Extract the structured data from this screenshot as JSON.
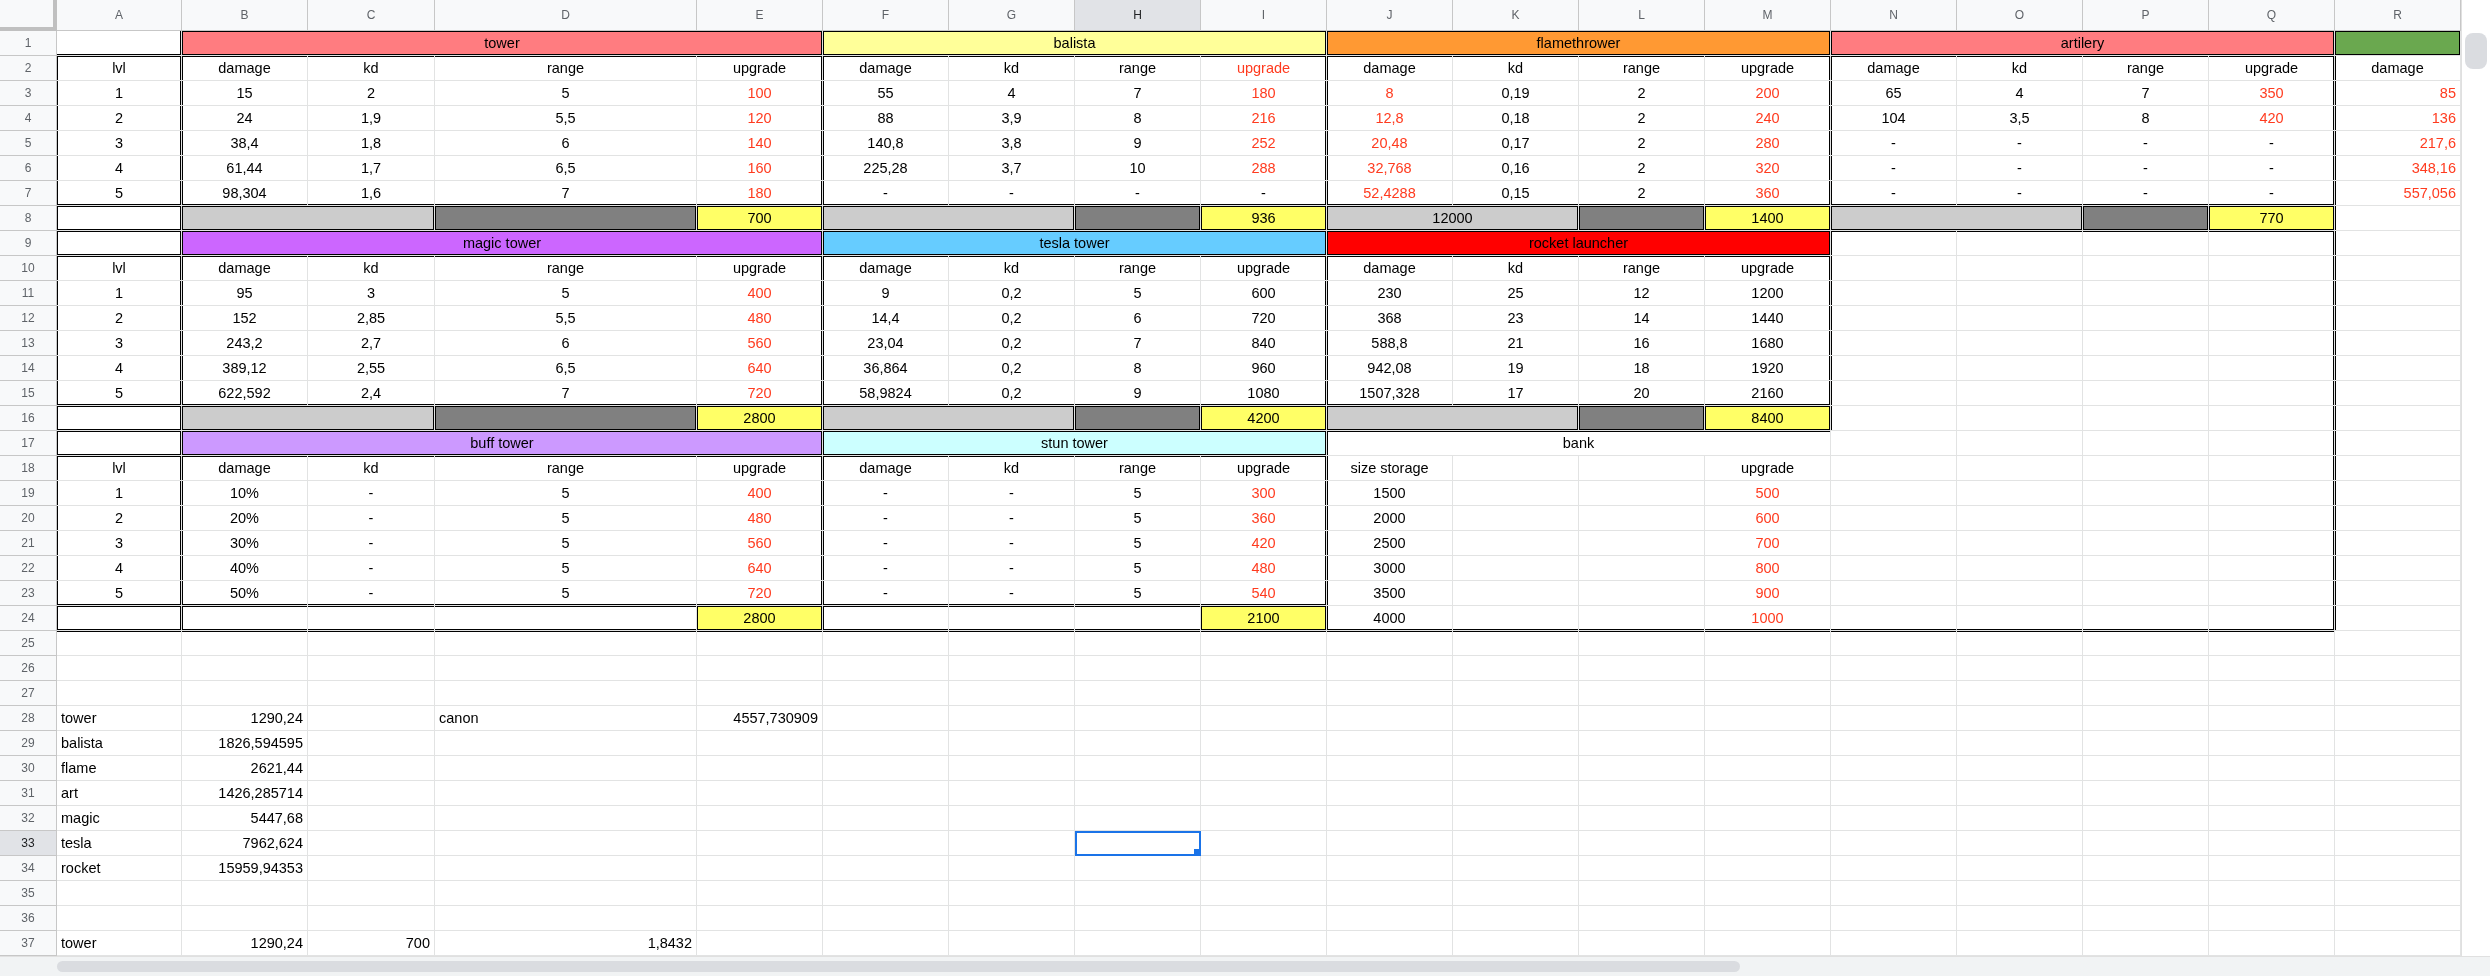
{
  "columns": [
    {
      "label": "A",
      "selected": false
    },
    {
      "label": "B",
      "selected": false
    },
    {
      "label": "C",
      "selected": false
    },
    {
      "label": "D",
      "selected": false
    },
    {
      "label": "E",
      "selected": false
    },
    {
      "label": "F",
      "selected": false
    },
    {
      "label": "G",
      "selected": false
    },
    {
      "label": "H",
      "selected": true
    },
    {
      "label": "I",
      "selected": false
    },
    {
      "label": "J",
      "selected": false
    },
    {
      "label": "K",
      "selected": false
    },
    {
      "label": "L",
      "selected": false
    },
    {
      "label": "M",
      "selected": false
    },
    {
      "label": "N",
      "selected": false
    },
    {
      "label": "O",
      "selected": false
    },
    {
      "label": "P",
      "selected": false
    },
    {
      "label": "Q",
      "selected": false
    },
    {
      "label": "R",
      "selected": false
    }
  ],
  "rows": [
    {
      "number": "1",
      "selected": false,
      "cells": [
        {
          "kind": "blank"
        },
        {
          "kind": "text",
          "text": "tower",
          "color": "#ff7c80"
        },
        {
          "kind": "merged"
        },
        {
          "kind": "merged"
        },
        {
          "kind": "merged"
        },
        {
          "kind": "text",
          "text": "balista",
          "color": "#ffff99"
        },
        {
          "kind": "merged"
        },
        {
          "kind": "merged"
        },
        {
          "kind": "merged"
        },
        {
          "kind": "text",
          "text": "flamethrower",
          "color": "#ff9933"
        },
        {
          "kind": "merged"
        },
        {
          "kind": "merged"
        },
        {
          "kind": "merged"
        },
        {
          "kind": "text",
          "text": "artilery",
          "color": "#ff7c80"
        },
        {
          "kind": "merged"
        },
        {
          "kind": "merged"
        },
        {
          "kind": "merged"
        },
        {
          "kind": "blank",
          "color": "#6aa84f"
        }
      ]
    },
    {
      "number": "2",
      "selected": false,
      "cells": [
        {
          "kind": "text",
          "text": "lvl"
        },
        {
          "kind": "text",
          "text": "damage"
        },
        {
          "kind": "text",
          "text": "kd"
        },
        {
          "kind": "text",
          "text": "range"
        },
        {
          "kind": "text",
          "text": "upgrade"
        },
        {
          "kind": "text",
          "text": "damage"
        },
        {
          "kind": "text",
          "text": "kd"
        },
        {
          "kind": "text",
          "text": "range"
        },
        {
          "kind": "flagged",
          "text": "upgrade"
        },
        {
          "kind": "text",
          "text": "damage"
        },
        {
          "kind": "text",
          "text": "kd"
        },
        {
          "kind": "text",
          "text": "range"
        },
        {
          "kind": "text",
          "text": "upgrade"
        },
        {
          "kind": "text",
          "text": "damage"
        },
        {
          "kind": "text",
          "text": "kd"
        },
        {
          "kind": "text",
          "text": "range"
        },
        {
          "kind": "text",
          "text": "upgrade"
        },
        {
          "kind": "text",
          "text": "damage"
        }
      ]
    },
    {
      "number": "3",
      "selected": false,
      "cells": [
        {
          "kind": "text",
          "text": "1"
        },
        {
          "kind": "text",
          "text": "15"
        },
        {
          "kind": "text",
          "text": "2"
        },
        {
          "kind": "text",
          "text": "5"
        },
        {
          "kind": "flagged",
          "text": "100"
        },
        {
          "kind": "text",
          "text": "55"
        },
        {
          "kind": "text",
          "text": "4"
        },
        {
          "kind": "text",
          "text": "7"
        },
        {
          "kind": "flagged",
          "text": "180"
        },
        {
          "kind": "flagged",
          "text": "8"
        },
        {
          "kind": "text",
          "text": "0,19"
        },
        {
          "kind": "text",
          "text": "2"
        },
        {
          "kind": "flagged",
          "text": "200"
        },
        {
          "kind": "text",
          "text": "65"
        },
        {
          "kind": "text",
          "text": "4"
        },
        {
          "kind": "text",
          "text": "7"
        },
        {
          "kind": "flagged",
          "text": "350"
        },
        {
          "kind": "alert",
          "text": "85"
        }
      ]
    },
    {
      "number": "4",
      "selected": false,
      "cells": [
        {
          "kind": "text",
          "text": "2"
        },
        {
          "kind": "text",
          "text": "24"
        },
        {
          "kind": "text",
          "text": "1,9"
        },
        {
          "kind": "text",
          "text": "5,5"
        },
        {
          "kind": "flagged",
          "text": "120"
        },
        {
          "kind": "text",
          "text": "88"
        },
        {
          "kind": "text",
          "text": "3,9"
        },
        {
          "kind": "text",
          "text": "8"
        },
        {
          "kind": "flagged",
          "text": "216"
        },
        {
          "kind": "flagged",
          "text": "12,8"
        },
        {
          "kind": "text",
          "text": "0,18"
        },
        {
          "kind": "text",
          "text": "2"
        },
        {
          "kind": "flagged",
          "text": "240"
        },
        {
          "kind": "text",
          "text": "104"
        },
        {
          "kind": "text",
          "text": "3,5"
        },
        {
          "kind": "text",
          "text": "8"
        },
        {
          "kind": "flagged",
          "text": "420"
        },
        {
          "kind": "alert",
          "text": "136"
        }
      ]
    },
    {
      "number": "5",
      "selected": false,
      "cells": [
        {
          "kind": "text",
          "text": "3"
        },
        {
          "kind": "text",
          "text": "38,4"
        },
        {
          "kind": "text",
          "text": "1,8"
        },
        {
          "kind": "text",
          "text": "6"
        },
        {
          "kind": "flagged",
          "text": "140"
        },
        {
          "kind": "text",
          "text": "140,8"
        },
        {
          "kind": "text",
          "text": "3,8"
        },
        {
          "kind": "text",
          "text": "9"
        },
        {
          "kind": "flagged",
          "text": "252"
        },
        {
          "kind": "flagged",
          "text": "20,48"
        },
        {
          "kind": "text",
          "text": "0,17"
        },
        {
          "kind": "text",
          "text": "2"
        },
        {
          "kind": "flagged",
          "text": "280"
        },
        {
          "kind": "text",
          "text": "-"
        },
        {
          "kind": "text",
          "text": "-"
        },
        {
          "kind": "text",
          "text": "-"
        },
        {
          "kind": "text",
          "text": "-"
        },
        {
          "kind": "alert",
          "text": "217,6"
        }
      ]
    },
    {
      "number": "6",
      "selected": false,
      "cells": [
        {
          "kind": "text",
          "text": "4"
        },
        {
          "kind": "text",
          "text": "61,44"
        },
        {
          "kind": "text",
          "text": "1,7"
        },
        {
          "kind": "text",
          "text": "6,5"
        },
        {
          "kind": "flagged",
          "text": "160"
        },
        {
          "kind": "text",
          "text": "225,28"
        },
        {
          "kind": "text",
          "text": "3,7"
        },
        {
          "kind": "text",
          "text": "10"
        },
        {
          "kind": "flagged",
          "text": "288"
        },
        {
          "kind": "flagged",
          "text": "32,768"
        },
        {
          "kind": "text",
          "text": "0,16"
        },
        {
          "kind": "text",
          "text": "2"
        },
        {
          "kind": "flagged",
          "text": "320"
        },
        {
          "kind": "text",
          "text": "-"
        },
        {
          "kind": "text",
          "text": "-"
        },
        {
          "kind": "text",
          "text": "-"
        },
        {
          "kind": "text",
          "text": "-"
        },
        {
          "kind": "alert",
          "text": "348,16"
        }
      ]
    },
    {
      "number": "7",
      "selected": false,
      "cells": [
        {
          "kind": "text",
          "text": "5"
        },
        {
          "kind": "text",
          "text": "98,304"
        },
        {
          "kind": "text",
          "text": "1,6"
        },
        {
          "kind": "text",
          "text": "7"
        },
        {
          "kind": "flagged",
          "text": "180"
        },
        {
          "kind": "text",
          "text": "-"
        },
        {
          "kind": "text",
          "text": "-"
        },
        {
          "kind": "text",
          "text": "-"
        },
        {
          "kind": "text",
          "text": "-"
        },
        {
          "kind": "flagged",
          "text": "52,4288"
        },
        {
          "kind": "text",
          "text": "0,15"
        },
        {
          "kind": "text",
          "text": "2"
        },
        {
          "kind": "flagged",
          "text": "360"
        },
        {
          "kind": "text",
          "text": "-"
        },
        {
          "kind": "text",
          "text": "-"
        },
        {
          "kind": "text",
          "text": "-"
        },
        {
          "kind": "text",
          "text": "-"
        },
        {
          "kind": "alert",
          "text": "557,056"
        }
      ]
    },
    {
      "number": "8",
      "selected": false,
      "cells": [
        {
          "kind": "blank"
        },
        {
          "kind": "blank",
          "color": "#cccccc"
        },
        {
          "kind": "merged"
        },
        {
          "kind": "blank",
          "color": "#808080"
        },
        {
          "kind": "text",
          "text": "700",
          "color": "#ffff66"
        },
        {
          "kind": "blank",
          "color": "#cccccc"
        },
        {
          "kind": "merged"
        },
        {
          "kind": "blank",
          "color": "#808080"
        },
        {
          "kind": "text",
          "text": "936",
          "color": "#ffff66"
        },
        {
          "kind": "text",
          "text": "12000",
          "color": "#cccccc"
        },
        {
          "kind": "merged"
        },
        {
          "kind": "blank",
          "color": "#808080"
        },
        {
          "kind": "text",
          "text": "1400",
          "color": "#ffff66"
        },
        {
          "kind": "blank",
          "color": "#cccccc"
        },
        {
          "kind": "merged"
        },
        {
          "kind": "blank",
          "color": "#808080"
        },
        {
          "kind": "text",
          "text": "770",
          "color": "#ffff66"
        }
      ]
    },
    {
      "number": "9",
      "selected": false,
      "cells": [
        {
          "kind": "blank"
        },
        {
          "kind": "text",
          "text": "magic tower",
          "color": "#cc66ff"
        },
        {
          "kind": "merged"
        },
        {
          "kind": "merged"
        },
        {
          "kind": "merged"
        },
        {
          "kind": "text",
          "text": "tesla tower",
          "color": "#66ccff"
        },
        {
          "kind": "merged"
        },
        {
          "kind": "merged"
        },
        {
          "kind": "merged"
        },
        {
          "kind": "text",
          "text": "rocket launcher",
          "color": "#ff0000"
        },
        {
          "kind": "merged"
        },
        {
          "kind": "merged"
        },
        {
          "kind": "merged"
        }
      ]
    },
    {
      "number": "10",
      "selected": false,
      "cells": [
        {
          "kind": "text",
          "text": "lvl"
        },
        {
          "kind": "text",
          "text": "damage"
        },
        {
          "kind": "text",
          "text": "kd"
        },
        {
          "kind": "text",
          "text": "range"
        },
        {
          "kind": "text",
          "text": "upgrade"
        },
        {
          "kind": "text",
          "text": "damage"
        },
        {
          "kind": "text",
          "text": "kd"
        },
        {
          "kind": "text",
          "text": "range"
        },
        {
          "kind": "text",
          "text": "upgrade"
        },
        {
          "kind": "text",
          "text": "damage"
        },
        {
          "kind": "text",
          "text": "kd"
        },
        {
          "kind": "text",
          "text": "range"
        },
        {
          "kind": "text",
          "text": "upgrade"
        }
      ]
    },
    {
      "number": "11",
      "selected": false,
      "cells": [
        {
          "kind": "text",
          "text": "1"
        },
        {
          "kind": "text",
          "text": "95"
        },
        {
          "kind": "text",
          "text": "3"
        },
        {
          "kind": "text",
          "text": "5"
        },
        {
          "kind": "flagged",
          "text": "400"
        },
        {
          "kind": "text",
          "text": "9"
        },
        {
          "kind": "text",
          "text": "0,2"
        },
        {
          "kind": "text",
          "text": "5"
        },
        {
          "kind": "text",
          "text": "600"
        },
        {
          "kind": "text",
          "text": "230"
        },
        {
          "kind": "text",
          "text": "25"
        },
        {
          "kind": "text",
          "text": "12"
        },
        {
          "kind": "text",
          "text": "1200"
        }
      ]
    },
    {
      "number": "12",
      "selected": false,
      "cells": [
        {
          "kind": "text",
          "text": "2"
        },
        {
          "kind": "text",
          "text": "152"
        },
        {
          "kind": "text",
          "text": "2,85"
        },
        {
          "kind": "text",
          "text": "5,5"
        },
        {
          "kind": "flagged",
          "text": "480"
        },
        {
          "kind": "text",
          "text": "14,4"
        },
        {
          "kind": "text",
          "text": "0,2"
        },
        {
          "kind": "text",
          "text": "6"
        },
        {
          "kind": "text",
          "text": "720"
        },
        {
          "kind": "text",
          "text": "368"
        },
        {
          "kind": "text",
          "text": "23"
        },
        {
          "kind": "text",
          "text": "14"
        },
        {
          "kind": "text",
          "text": "1440"
        }
      ]
    },
    {
      "number": "13",
      "selected": false,
      "cells": [
        {
          "kind": "text",
          "text": "3"
        },
        {
          "kind": "text",
          "text": "243,2"
        },
        {
          "kind": "text",
          "text": "2,7"
        },
        {
          "kind": "text",
          "text": "6"
        },
        {
          "kind": "flagged",
          "text": "560"
        },
        {
          "kind": "text",
          "text": "23,04"
        },
        {
          "kind": "text",
          "text": "0,2"
        },
        {
          "kind": "text",
          "text": "7"
        },
        {
          "kind": "text",
          "text": "840"
        },
        {
          "kind": "text",
          "text": "588,8"
        },
        {
          "kind": "text",
          "text": "21"
        },
        {
          "kind": "text",
          "text": "16"
        },
        {
          "kind": "text",
          "text": "1680"
        }
      ]
    },
    {
      "number": "14",
      "selected": false,
      "cells": [
        {
          "kind": "text",
          "text": "4"
        },
        {
          "kind": "text",
          "text": "389,12"
        },
        {
          "kind": "text",
          "text": "2,55"
        },
        {
          "kind": "text",
          "text": "6,5"
        },
        {
          "kind": "flagged",
          "text": "640"
        },
        {
          "kind": "text",
          "text": "36,864"
        },
        {
          "kind": "text",
          "text": "0,2"
        },
        {
          "kind": "text",
          "text": "8"
        },
        {
          "kind": "text",
          "text": "960"
        },
        {
          "kind": "text",
          "text": "942,08"
        },
        {
          "kind": "text",
          "text": "19"
        },
        {
          "kind": "text",
          "text": "18"
        },
        {
          "kind": "text",
          "text": "1920"
        }
      ]
    },
    {
      "number": "15",
      "selected": false,
      "cells": [
        {
          "kind": "text",
          "text": "5"
        },
        {
          "kind": "text",
          "text": "622,592"
        },
        {
          "kind": "text",
          "text": "2,4"
        },
        {
          "kind": "text",
          "text": "7"
        },
        {
          "kind": "flagged",
          "text": "720"
        },
        {
          "kind": "text",
          "text": "58,9824"
        },
        {
          "kind": "text",
          "text": "0,2"
        },
        {
          "kind": "text",
          "text": "9"
        },
        {
          "kind": "text",
          "text": "1080"
        },
        {
          "kind": "text",
          "text": "1507,328"
        },
        {
          "kind": "text",
          "text": "17"
        },
        {
          "kind": "text",
          "text": "20"
        },
        {
          "kind": "text",
          "text": "2160"
        }
      ]
    },
    {
      "number": "16",
      "selected": false,
      "cells": [
        {
          "kind": "blank"
        },
        {
          "kind": "blank",
          "color": "#cccccc"
        },
        {
          "kind": "merged"
        },
        {
          "kind": "blank",
          "color": "#808080"
        },
        {
          "kind": "text",
          "text": "2800",
          "color": "#ffff66"
        },
        {
          "kind": "blank",
          "color": "#cccccc"
        },
        {
          "kind": "merged"
        },
        {
          "kind": "blank",
          "color": "#808080"
        },
        {
          "kind": "text",
          "text": "4200",
          "color": "#ffff66"
        },
        {
          "kind": "blank",
          "color": "#cccccc"
        },
        {
          "kind": "merged"
        },
        {
          "kind": "blank",
          "color": "#808080"
        },
        {
          "kind": "text",
          "text": "8400",
          "color": "#ffff66"
        }
      ]
    },
    {
      "number": "17",
      "selected": false,
      "cells": [
        {
          "kind": "blank"
        },
        {
          "kind": "text",
          "text": "buff tower",
          "color": "#cc99ff"
        },
        {
          "kind": "merged"
        },
        {
          "kind": "merged"
        },
        {
          "kind": "merged"
        },
        {
          "kind": "text",
          "text": "stun tower",
          "color": "#ccffff"
        },
        {
          "kind": "merged"
        },
        {
          "kind": "merged"
        },
        {
          "kind": "merged"
        },
        {
          "kind": "text",
          "text": "bank"
        },
        {
          "kind": "merged"
        },
        {
          "kind": "merged"
        },
        {
          "kind": "merged"
        }
      ]
    },
    {
      "number": "18",
      "selected": false,
      "cells": [
        {
          "kind": "text",
          "text": "lvl"
        },
        {
          "kind": "text",
          "text": "damage"
        },
        {
          "kind": "text",
          "text": "kd"
        },
        {
          "kind": "text",
          "text": "range"
        },
        {
          "kind": "text",
          "text": "upgrade"
        },
        {
          "kind": "text",
          "text": "damage"
        },
        {
          "kind": "text",
          "text": "kd"
        },
        {
          "kind": "text",
          "text": "range"
        },
        {
          "kind": "text",
          "text": "upgrade"
        },
        {
          "kind": "text",
          "text": "size storage"
        },
        {
          "kind": "blank"
        },
        {
          "kind": "blank"
        },
        {
          "kind": "text",
          "text": "upgrade"
        }
      ]
    },
    {
      "number": "19",
      "selected": false,
      "cells": [
        {
          "kind": "text",
          "text": "1"
        },
        {
          "kind": "text",
          "text": "10%"
        },
        {
          "kind": "text",
          "text": "-"
        },
        {
          "kind": "text",
          "text": "5"
        },
        {
          "kind": "flagged",
          "text": "400"
        },
        {
          "kind": "text",
          "text": "-"
        },
        {
          "kind": "text",
          "text": "-"
        },
        {
          "kind": "text",
          "text": "5"
        },
        {
          "kind": "flagged",
          "text": "300"
        },
        {
          "kind": "text",
          "text": "1500"
        },
        {
          "kind": "blank"
        },
        {
          "kind": "blank"
        },
        {
          "kind": "flagged",
          "text": "500"
        }
      ]
    },
    {
      "number": "20",
      "selected": false,
      "cells": [
        {
          "kind": "text",
          "text": "2"
        },
        {
          "kind": "text",
          "text": "20%"
        },
        {
          "kind": "text",
          "text": "-"
        },
        {
          "kind": "text",
          "text": "5"
        },
        {
          "kind": "flagged",
          "text": "480"
        },
        {
          "kind": "text",
          "text": "-"
        },
        {
          "kind": "text",
          "text": "-"
        },
        {
          "kind": "text",
          "text": "5"
        },
        {
          "kind": "flagged",
          "text": "360"
        },
        {
          "kind": "text",
          "text": "2000"
        },
        {
          "kind": "blank"
        },
        {
          "kind": "blank"
        },
        {
          "kind": "flagged",
          "text": "600"
        }
      ]
    },
    {
      "number": "21",
      "selected": false,
      "cells": [
        {
          "kind": "text",
          "text": "3"
        },
        {
          "kind": "text",
          "text": "30%"
        },
        {
          "kind": "text",
          "text": "-"
        },
        {
          "kind": "text",
          "text": "5"
        },
        {
          "kind": "flagged",
          "text": "560"
        },
        {
          "kind": "text",
          "text": "-"
        },
        {
          "kind": "text",
          "text": "-"
        },
        {
          "kind": "text",
          "text": "5"
        },
        {
          "kind": "flagged",
          "text": "420"
        },
        {
          "kind": "text",
          "text": "2500"
        },
        {
          "kind": "blank"
        },
        {
          "kind": "blank"
        },
        {
          "kind": "flagged",
          "text": "700"
        }
      ]
    },
    {
      "number": "22",
      "selected": false,
      "cells": [
        {
          "kind": "text",
          "text": "4"
        },
        {
          "kind": "text",
          "text": "40%"
        },
        {
          "kind": "text",
          "text": "-"
        },
        {
          "kind": "text",
          "text": "5"
        },
        {
          "kind": "flagged",
          "text": "640"
        },
        {
          "kind": "text",
          "text": "-"
        },
        {
          "kind": "text",
          "text": "-"
        },
        {
          "kind": "text",
          "text": "5"
        },
        {
          "kind": "flagged",
          "text": "480"
        },
        {
          "kind": "text",
          "text": "3000"
        },
        {
          "kind": "blank"
        },
        {
          "kind": "blank"
        },
        {
          "kind": "flagged",
          "text": "800"
        }
      ]
    },
    {
      "number": "23",
      "selected": false,
      "cells": [
        {
          "kind": "text",
          "text": "5"
        },
        {
          "kind": "text",
          "text": "50%"
        },
        {
          "kind": "text",
          "text": "-"
        },
        {
          "kind": "text",
          "text": "5"
        },
        {
          "kind": "flagged",
          "text": "720"
        },
        {
          "kind": "text",
          "text": "-"
        },
        {
          "kind": "text",
          "text": "-"
        },
        {
          "kind": "text",
          "text": "5"
        },
        {
          "kind": "flagged",
          "text": "540"
        },
        {
          "kind": "text",
          "text": "3500"
        },
        {
          "kind": "blank"
        },
        {
          "kind": "blank"
        },
        {
          "kind": "flagged",
          "text": "900"
        }
      ]
    },
    {
      "number": "24",
      "selected": false,
      "cells": [
        {
          "kind": "blank"
        },
        {
          "kind": "blank"
        },
        {
          "kind": "blank"
        },
        {
          "kind": "blank"
        },
        {
          "kind": "text",
          "text": "2800",
          "color": "#ffff66"
        },
        {
          "kind": "blank"
        },
        {
          "kind": "blank"
        },
        {
          "kind": "blank"
        },
        {
          "kind": "text",
          "text": "2100",
          "color": "#ffff66"
        },
        {
          "kind": "text",
          "text": "4000"
        },
        {
          "kind": "blank"
        },
        {
          "kind": "blank"
        },
        {
          "kind": "flagged",
          "text": "1000"
        }
      ]
    },
    {
      "number": "25",
      "selected": false
    },
    {
      "number": "26",
      "selected": false
    },
    {
      "number": "27",
      "selected": false
    },
    {
      "number": "28",
      "selected": false,
      "cells": [
        {
          "kind": "label",
          "text": "tower"
        },
        {
          "kind": "number",
          "text": "1290,24"
        },
        {
          "kind": "blank"
        },
        {
          "kind": "label",
          "text": "canon"
        },
        {
          "kind": "number",
          "text": "4557,730909"
        }
      ]
    },
    {
      "number": "29",
      "selected": false,
      "cells": [
        {
          "kind": "label",
          "text": "balista"
        },
        {
          "kind": "number",
          "text": "1826,594595"
        }
      ]
    },
    {
      "number": "30",
      "selected": false,
      "cells": [
        {
          "kind": "label",
          "text": "flame"
        },
        {
          "kind": "number",
          "text": "2621,44"
        }
      ]
    },
    {
      "number": "31",
      "selected": false,
      "cells": [
        {
          "kind": "label",
          "text": "art"
        },
        {
          "kind": "number",
          "text": "1426,285714"
        }
      ]
    },
    {
      "number": "32",
      "selected": false,
      "cells": [
        {
          "kind": "label",
          "text": "magic"
        },
        {
          "kind": "number",
          "text": "5447,68"
        }
      ]
    },
    {
      "number": "33",
      "selected": true,
      "cells": [
        {
          "kind": "label",
          "text": "tesla"
        },
        {
          "kind": "number",
          "text": "7962,624"
        }
      ]
    },
    {
      "number": "34",
      "selected": false,
      "cells": [
        {
          "kind": "label",
          "text": "rocket"
        },
        {
          "kind": "number",
          "text": "15959,94353"
        }
      ]
    },
    {
      "number": "35",
      "selected": false
    },
    {
      "number": "36",
      "selected": false
    },
    {
      "number": "37",
      "selected": false,
      "cells": [
        {
          "kind": "label",
          "text": "tower"
        },
        {
          "kind": "number",
          "text": "1290,24"
        },
        {
          "kind": "number",
          "text": "700"
        },
        {
          "kind": "number",
          "text": "1,8432"
        }
      ]
    }
  ]
}
